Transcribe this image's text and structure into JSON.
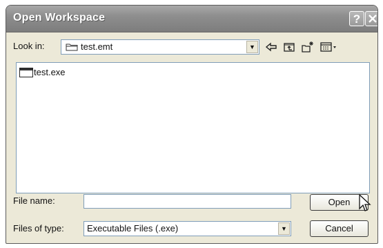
{
  "window": {
    "title": "Open Workspace",
    "help_label": "?",
    "close_label": "X"
  },
  "lookin": {
    "label": "Look in:",
    "value": "test.emt"
  },
  "toolbar": {
    "icons": [
      "back-icon",
      "up-folder-icon",
      "new-folder-icon",
      "view-menu-icon"
    ]
  },
  "files": [
    {
      "name": "test.exe",
      "icon": "exe-file-icon"
    }
  ],
  "filename": {
    "label": "File name:",
    "value": ""
  },
  "filetype": {
    "label": "Files of type:",
    "value": "Executable Files (.exe)"
  },
  "buttons": {
    "open": "Open",
    "cancel": "Cancel"
  },
  "colors": {
    "titlebar": "#8e8e8e",
    "dialog_bg": "#ece9d8",
    "field_border": "#7f9db9"
  }
}
